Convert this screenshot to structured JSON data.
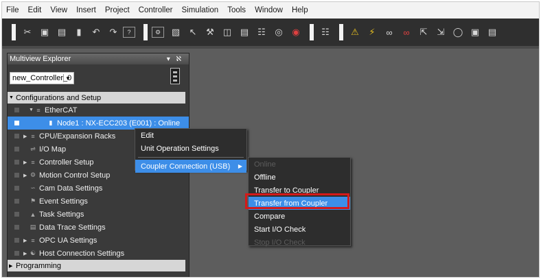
{
  "menubar": {
    "items": [
      "File",
      "Edit",
      "View",
      "Insert",
      "Project",
      "Controller",
      "Simulation",
      "Tools",
      "Window",
      "Help"
    ]
  },
  "toolbar": {
    "icons": [
      "cut-icon",
      "copy-icon",
      "paste-icon",
      "delete-icon",
      "undo-icon",
      "redo-icon",
      "help-icon",
      "build-icon",
      "window-icon",
      "pointer-icon",
      "settings-icon",
      "compare-icon",
      "print-icon",
      "io-icon",
      "search-icon",
      "stop-icon",
      "sync-icon",
      "warning-icon",
      "online-icon",
      "link-icon",
      "transfer-icon",
      "upload-icon",
      "download-icon",
      "refresh-icon",
      "program-icon",
      "monitor-icon"
    ]
  },
  "explorer": {
    "title": "Multiview Explorer",
    "pin": "▾ ℵ",
    "controller": "new_Controller_0",
    "config_header": "Configurations and Setup",
    "tree": [
      {
        "label": "EtherCAT",
        "icon": "ethercat-icon"
      },
      {
        "label": "Node1 : NX-ECC203 (E001) : Online",
        "icon": "node-icon"
      },
      {
        "label": "CPU/Expansion Racks",
        "icon": "rack-icon"
      },
      {
        "label": "I/O Map",
        "icon": "iomap-icon"
      },
      {
        "label": "Controller Setup",
        "icon": "controller-setup-icon"
      },
      {
        "label": "Motion Control Setup",
        "icon": "motion-icon"
      },
      {
        "label": "Cam Data Settings",
        "icon": "cam-icon"
      },
      {
        "label": "Event Settings",
        "icon": "event-icon"
      },
      {
        "label": "Task Settings",
        "icon": "task-icon"
      },
      {
        "label": "Data Trace Settings",
        "icon": "trace-icon"
      },
      {
        "label": "OPC UA Settings",
        "icon": "opcua-icon"
      },
      {
        "label": "Host Connection Settings",
        "icon": "host-icon"
      }
    ],
    "programming_header": "Programming"
  },
  "context_menu": {
    "items": [
      "Edit",
      "Unit Operation Settings",
      "Coupler Connection (USB)"
    ]
  },
  "submenu": {
    "items": [
      "Online",
      "Offline",
      "Transfer to Coupler",
      "Transfer from Coupler",
      "Compare",
      "Start I/O Check",
      "Stop I/O Check"
    ]
  },
  "colors": {
    "selection": "#3d8ee8",
    "highlight_box": "#d41a1a",
    "workspace": "#5d5d5d"
  }
}
